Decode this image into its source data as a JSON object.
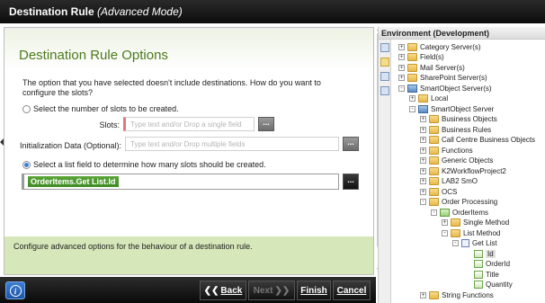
{
  "window": {
    "title": "Destination Rule",
    "mode": "(Advanced Mode)"
  },
  "wizard": {
    "heading": "Destination Rule Options",
    "intro": "The option that you have selected doesn't include destinations. How do you want to configure the slots?",
    "option1_label": "Select the number of slots to be created.",
    "slots_label": "Slots:",
    "slots_placeholder": "Type text and/or Drop a single field",
    "init_label": "Initialization Data (Optional):",
    "init_placeholder": "Type text and/or Drop multiple fields",
    "option2_label": "Select a list field to determine how many slots should be created.",
    "list_field_token": "OrderItems.Get List.Id",
    "ellipsis": "...",
    "info_text": "Configure advanced options for the behaviour of a destination rule."
  },
  "footer": {
    "info_icon": "i",
    "back": "Back",
    "next": "Next",
    "finish": "Finish",
    "cancel": "Cancel"
  },
  "environment": {
    "title": "Environment (Development)",
    "tree": [
      {
        "label": "Category Server(s)",
        "icon": "folder-icon",
        "state": "+"
      },
      {
        "label": "Field(s)",
        "icon": "folder-icon",
        "state": "+"
      },
      {
        "label": "Mail Server(s)",
        "icon": "folder-icon",
        "state": "+"
      },
      {
        "label": "SharePoint Server(s)",
        "icon": "folder-icon",
        "state": "+"
      },
      {
        "label": "SmartObject Server(s)",
        "icon": "server-icon",
        "state": "-"
      },
      {
        "label": "Local",
        "icon": "folder-icon",
        "state": "+"
      },
      {
        "label": "SmartObject Server",
        "icon": "server-icon",
        "state": "-"
      },
      {
        "label": "Business Objects",
        "icon": "folder-icon",
        "state": "+"
      },
      {
        "label": "Business Rules",
        "icon": "folder-icon",
        "state": "+"
      },
      {
        "label": "Call Centre Business Objects",
        "icon": "folder-icon",
        "state": "+"
      },
      {
        "label": "Functions",
        "icon": "folder-icon",
        "state": "+"
      },
      {
        "label": "Generic Objects",
        "icon": "folder-icon",
        "state": "+"
      },
      {
        "label": "K2WorkflowProject2",
        "icon": "folder-icon",
        "state": "+"
      },
      {
        "label": "LAB2 SmO",
        "icon": "folder-icon",
        "state": "+"
      },
      {
        "label": "OCS",
        "icon": "folder-icon",
        "state": "+"
      },
      {
        "label": "Order Processing",
        "icon": "folder-icon",
        "state": "-"
      },
      {
        "label": "OrderItems",
        "icon": "smartobject-icon",
        "state": "-"
      },
      {
        "label": "Single Method",
        "icon": "folder-icon",
        "state": "+"
      },
      {
        "label": "List Method",
        "icon": "folder-icon",
        "state": "-"
      },
      {
        "label": "Get List",
        "icon": "list-icon",
        "state": "-"
      },
      {
        "label": "Id",
        "icon": "property-icon",
        "state": ""
      },
      {
        "label": "OrderId",
        "icon": "property-icon",
        "state": ""
      },
      {
        "label": "Title",
        "icon": "property-icon",
        "state": ""
      },
      {
        "label": "Quantity",
        "icon": "property-icon",
        "state": ""
      },
      {
        "label": "String Functions",
        "icon": "folder-icon",
        "state": "+"
      }
    ]
  }
}
